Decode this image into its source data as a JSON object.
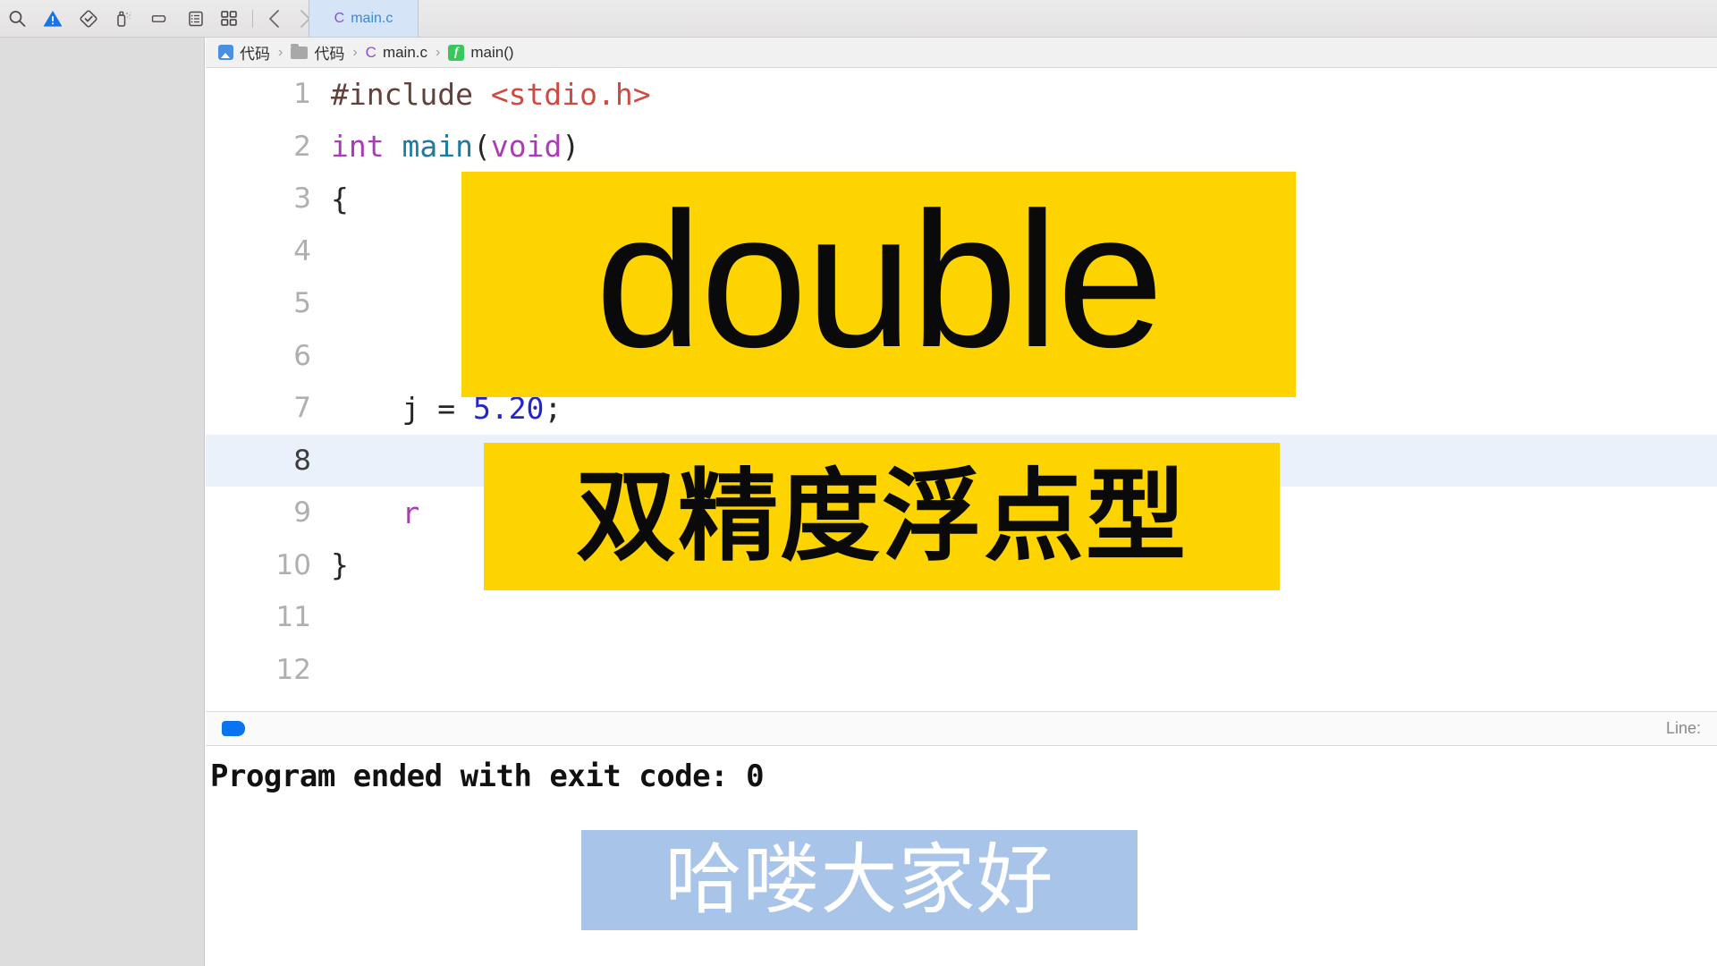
{
  "toolbar": {
    "icons": [
      {
        "name": "search-icon",
        "label": "Search"
      },
      {
        "name": "warning-triangle-icon",
        "label": "Issues"
      },
      {
        "name": "check-diamond-icon",
        "label": "Tests"
      },
      {
        "name": "debug-spray-icon",
        "label": "Debug"
      },
      {
        "name": "tag-icon",
        "label": "Breakpoints"
      },
      {
        "name": "report-list-icon",
        "label": "Report"
      }
    ],
    "grid_icon": "grid-icon",
    "back_label": "‹",
    "forward_label": "›",
    "tab": {
      "file_type_glyph": "C",
      "filename": "main.c"
    }
  },
  "breadcrumb": {
    "items": [
      {
        "icon": "project-icon",
        "label": "代码"
      },
      {
        "icon": "folder-icon",
        "label": "代码"
      },
      {
        "icon": "c-file-icon",
        "label": "main.c"
      },
      {
        "icon": "function-icon",
        "label": "main()"
      }
    ],
    "separator": "›",
    "function_glyph": "f"
  },
  "editor": {
    "lines": [
      {
        "num": "1",
        "current": false,
        "tokens": [
          {
            "class": "tk-pre",
            "text": "#include "
          },
          {
            "class": "tk-str",
            "text": "<stdio.h>"
          }
        ]
      },
      {
        "num": "2",
        "current": false,
        "tokens": [
          {
            "class": "tk-kw",
            "text": "int "
          },
          {
            "class": "tk-fn",
            "text": "main"
          },
          {
            "class": "tk-plain",
            "text": "("
          },
          {
            "class": "tk-kw",
            "text": "void"
          },
          {
            "class": "tk-plain",
            "text": ")"
          }
        ]
      },
      {
        "num": "3",
        "current": false,
        "tokens": [
          {
            "class": "tk-plain",
            "text": "{"
          }
        ]
      },
      {
        "num": "4",
        "current": false,
        "tokens": []
      },
      {
        "num": "5",
        "current": false,
        "tokens": []
      },
      {
        "num": "6",
        "current": false,
        "tokens": []
      },
      {
        "num": "7",
        "current": false,
        "tokens": [
          {
            "class": "tk-plain",
            "text": "    j = "
          },
          {
            "class": "tk-num",
            "text": "5.20"
          },
          {
            "class": "tk-plain",
            "text": ";"
          }
        ]
      },
      {
        "num": "8",
        "current": true,
        "tokens": []
      },
      {
        "num": "9",
        "current": false,
        "tokens": [
          {
            "class": "tk-kw",
            "text": "    r"
          }
        ]
      },
      {
        "num": "10",
        "current": false,
        "tokens": [
          {
            "class": "tk-plain",
            "text": "}"
          }
        ]
      },
      {
        "num": "11",
        "current": false,
        "tokens": []
      },
      {
        "num": "12",
        "current": false,
        "tokens": []
      }
    ]
  },
  "debug_bar": {
    "status_indicator": "debug-pill",
    "right_label": "Line:"
  },
  "console": {
    "output": "Program ended with exit code: 0"
  },
  "overlays": {
    "banner_keyword": "double",
    "banner_translation": "双精度浮点型",
    "subtitle": "哈喽大家好"
  },
  "colors": {
    "banner_yellow": "#fdd400",
    "subtitle_blue": "#a8c4e8",
    "current_line": "#eaf1fb",
    "tab_active": "#d6e4f7",
    "accent_blue": "#0a74f0",
    "keyword_magenta": "#ad3ab8",
    "string_red": "#d04a41",
    "number_blue": "#2424cf",
    "function_teal": "#1f7a9e"
  }
}
